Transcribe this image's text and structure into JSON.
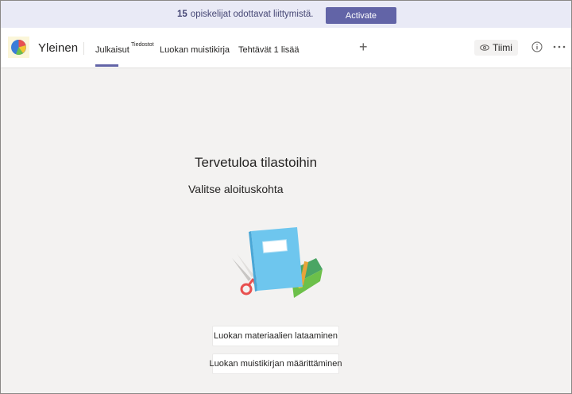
{
  "banner": {
    "count": "15",
    "message": "opiskelijat odottavat liittymistä.",
    "activate_label": "Activate"
  },
  "header": {
    "channel_name": "Yleinen",
    "tabs": [
      {
        "label": "Julkaisut",
        "active": true
      },
      {
        "label": "Tiedostot"
      },
      {
        "label": "Luokan muistikirja"
      },
      {
        "label": "Tehtävät 1 lisää"
      }
    ],
    "add_tab_icon": "plus-icon",
    "team_label": "Tiimi",
    "team_icon": "eye-icon",
    "info_icon": "info-icon",
    "more_icon": "more-icon"
  },
  "main": {
    "title": "Tervetuloa tilastoihin",
    "subtitle": "Valitse aloituskohta",
    "buttons": [
      {
        "label": "Luokan materiaalien lataaminen"
      },
      {
        "label": "Luokan muistikirjan määrittäminen"
      }
    ]
  },
  "colors": {
    "accent": "#6264a7",
    "banner_bg": "#e9eaf6",
    "page_bg": "#f3f2f1"
  }
}
